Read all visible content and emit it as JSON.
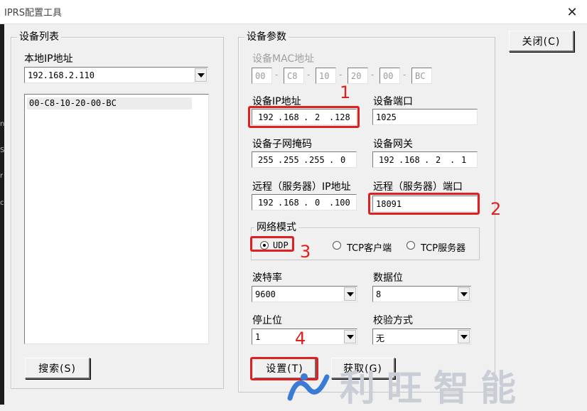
{
  "window": {
    "title": "IPRS配置工具",
    "close_glyph": "✕"
  },
  "left_edge_chars": [
    "n",
    "S",
    "r",
    "c"
  ],
  "device_list": {
    "legend": "设备列表",
    "local_ip_label": "本地IP地址",
    "local_ip_value": "192.168.2.110",
    "items": [
      "00-C8-10-20-00-BC"
    ],
    "search_button": "搜索(S)"
  },
  "close_button": "关闭(C)",
  "params": {
    "legend": "设备参数",
    "mac": {
      "label": "设备MAC地址",
      "octets": [
        "00",
        "C8",
        "10",
        "20",
        "00",
        "BC"
      ],
      "separator": "-"
    },
    "device_ip": {
      "label": "设备IP地址",
      "octets": [
        "192",
        "168",
        "2",
        "128"
      ]
    },
    "device_port": {
      "label": "设备端口",
      "value": "1025"
    },
    "subnet_mask": {
      "label": "设备子网掩码",
      "octets": [
        "255",
        "255",
        "255",
        "0"
      ]
    },
    "gateway": {
      "label": "设备网关",
      "octets": [
        "192",
        "168",
        "2",
        "1"
      ]
    },
    "remote_ip": {
      "label": "远程（服务器）IP地址",
      "octets": [
        "192",
        "168",
        "0",
        "100"
      ]
    },
    "remote_port": {
      "label": "远程（服务器）端口",
      "value": "18091"
    },
    "ip_separator": ".",
    "network_mode": {
      "legend": "网络模式",
      "options": [
        "UDP",
        "TCP客户端",
        "TCP服务器"
      ],
      "selected": "UDP"
    },
    "baud_rate": {
      "label": "波特率",
      "value": "9600"
    },
    "data_bits": {
      "label": "数据位",
      "value": "8"
    },
    "stop_bits": {
      "label": "停止位",
      "value": "1"
    },
    "parity": {
      "label": "校验方式",
      "value": "无"
    },
    "set_button": "设置(T)",
    "get_button": "获取(G)"
  },
  "annotations": {
    "color": "#e02020",
    "steps": [
      "1",
      "2",
      "3",
      "4"
    ]
  },
  "watermark": {
    "text": "利旺智能"
  }
}
